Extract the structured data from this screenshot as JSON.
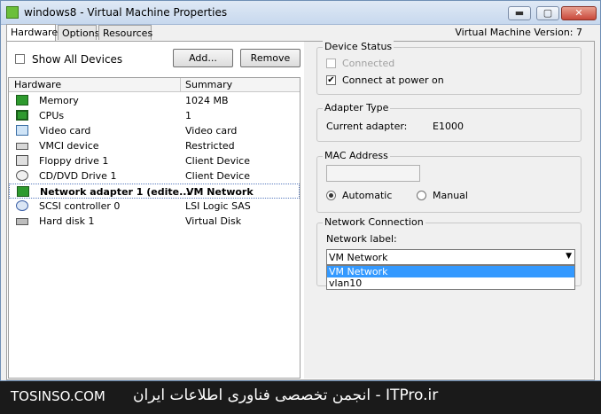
{
  "window": {
    "title": "windows8 - Virtual Machine Properties",
    "minimize_glyph": "▬",
    "maximize_glyph": "▢",
    "close_glyph": "✕"
  },
  "tabs": [
    {
      "label": "Hardware"
    },
    {
      "label": "Options"
    },
    {
      "label": "Resources"
    }
  ],
  "vm_version": "Virtual Machine Version: 7",
  "hardware_panel": {
    "show_all_label": "Show All Devices",
    "add_label": "Add...",
    "remove_label": "Remove",
    "col_hardware": "Hardware",
    "col_summary": "Summary",
    "rows": [
      {
        "name": "Memory",
        "summary": "1024 MB",
        "icon": "memory-icon"
      },
      {
        "name": "CPUs",
        "summary": "1",
        "icon": "cpu-icon"
      },
      {
        "name": "Video card",
        "summary": "Video card",
        "icon": "monitor-icon"
      },
      {
        "name": "VMCI device",
        "summary": "Restricted",
        "icon": "vmci-icon"
      },
      {
        "name": "Floppy drive 1",
        "summary": "Client Device",
        "icon": "floppy-icon"
      },
      {
        "name": "CD/DVD Drive 1",
        "summary": "Client Device",
        "icon": "cd-icon"
      },
      {
        "name": "Network adapter 1 (edite...",
        "summary": "VM Network",
        "icon": "network-icon"
      },
      {
        "name": "SCSI controller 0",
        "summary": "LSI Logic SAS",
        "icon": "scsi-icon"
      },
      {
        "name": "Hard disk 1",
        "summary": "Virtual Disk",
        "icon": "harddisk-icon"
      }
    ]
  },
  "device_status": {
    "title": "Device Status",
    "connected_label": "Connected",
    "connect_power_label": "Connect at power on",
    "check_glyph": "✔"
  },
  "adapter_type": {
    "title": "Adapter Type",
    "current_label": "Current adapter:",
    "current_value": "E1000"
  },
  "mac_address": {
    "title": "MAC Address",
    "value": "",
    "automatic_label": "Automatic",
    "manual_label": "Manual"
  },
  "network_connection": {
    "title": "Network Connection",
    "label": "Network label:",
    "selected": "VM Network",
    "arrow_glyph": "▼",
    "options": [
      "VM Network",
      "vlan10"
    ]
  },
  "watermark": {
    "left": "TOSINSO.COM",
    "right": "انجمن تخصصی فناوری اطلاعات ایران - ITPro.ir"
  },
  "colors": {
    "selection_highlight": "#3399ff",
    "icon_green": "#2e9a2e"
  }
}
